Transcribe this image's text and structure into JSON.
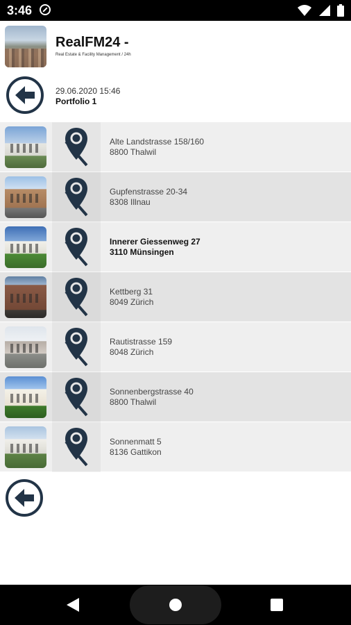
{
  "status_bar": {
    "time": "3:46",
    "icons": [
      "do-not-disturb-icon",
      "wifi-icon",
      "cell-signal-icon",
      "battery-icon"
    ]
  },
  "header": {
    "title": "RealFM24 -",
    "subtitle": "Real Estate & Facility Management / 24h"
  },
  "info": {
    "date": "29.06.2020 15:46",
    "portfolio": "Portfolio 1"
  },
  "properties": [
    {
      "street": "Alte Landstrasse 158/160",
      "city": "8800 Thalwil"
    },
    {
      "street": "Gupfenstrasse 20-34",
      "city": "8308 Illnau"
    },
    {
      "street": "Innerer Giessenweg 27",
      "city": "3110 Münsingen"
    },
    {
      "street": "Kettberg 31",
      "city": "8049 Zürich"
    },
    {
      "street": "Rautistrasse 159",
      "city": "8048 Zürich"
    },
    {
      "street": "Sonnenbergstrasse 40",
      "city": "8800 Thalwil"
    },
    {
      "street": "Sonnenmatt 5",
      "city": "8136 Gattikon"
    }
  ],
  "colors": {
    "accent": "#223447",
    "row_light": "#efefef",
    "row_dark": "#e3e3e3"
  }
}
